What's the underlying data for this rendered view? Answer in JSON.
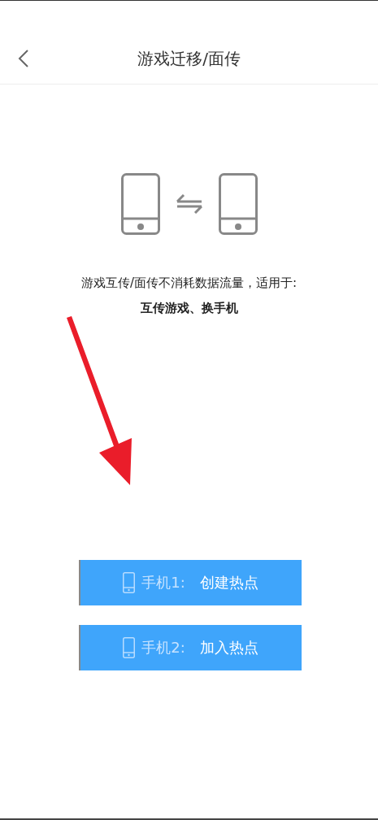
{
  "header": {
    "title": "游戏迁移/面传"
  },
  "intro": {
    "line_1": "游戏互传/面传不消耗数据流量，适用于:",
    "line_2": "互传游戏、换手机"
  },
  "buttons": [
    {
      "prefix": "手机1:",
      "label": "创建热点"
    },
    {
      "prefix": "手机2:",
      "label": "加入热点"
    }
  ]
}
